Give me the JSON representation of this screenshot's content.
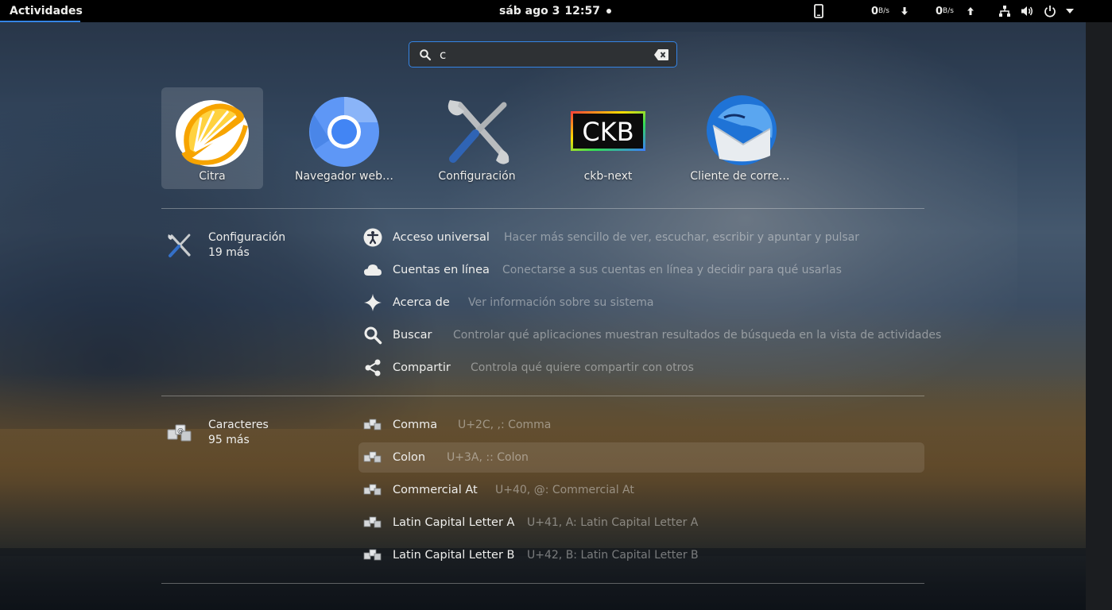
{
  "topbar": {
    "activities": "Actividades",
    "date": "sáb ago 3",
    "time": "12:57",
    "net_down_value": "0",
    "net_down_unit": "B/s",
    "net_up_value": "0",
    "net_up_unit": "B/s"
  },
  "search": {
    "value": "c"
  },
  "apps": [
    {
      "label": "Citra",
      "icon": "citra-icon",
      "selected": true
    },
    {
      "label": "Navegador web…",
      "icon": "chromium-icon",
      "selected": false
    },
    {
      "label": "Configuración",
      "icon": "settings-tools-icon",
      "selected": false
    },
    {
      "label": "ckb-next",
      "icon": "ckb-next-icon",
      "selected": false
    },
    {
      "label": "Cliente de corre…",
      "icon": "thunderbird-icon",
      "selected": false
    }
  ],
  "providers": [
    {
      "name": "Configuración",
      "more": "19 más",
      "icon": "settings-tools-icon",
      "results": [
        {
          "title": "Acceso universal",
          "desc": "Hacer más sencillo de ver, escuchar, escribir y apuntar y pulsar",
          "icon": "accessibility-icon"
        },
        {
          "title": "Cuentas en línea",
          "desc": "Conectarse a sus cuentas en línea y decidir para qué usarlas",
          "icon": "cloud-icon"
        },
        {
          "title": "Acerca de",
          "desc": "Ver información sobre su sistema",
          "icon": "sparkle-icon"
        },
        {
          "title": "Buscar",
          "desc": "Controlar qué aplicaciones muestran resultados de búsqueda en la vista de actividades",
          "icon": "search-icon"
        },
        {
          "title": "Compartir",
          "desc": "Controla qué quiere compartir con otros",
          "icon": "share-icon"
        }
      ]
    },
    {
      "name": "Caracteres",
      "more": "95 más",
      "icon": "characters-icon",
      "results": [
        {
          "title": "Comma",
          "desc": "U+2C, ,: Comma",
          "icon": "characters-icon"
        },
        {
          "title": "Colon",
          "desc": "U+3A, :: Colon",
          "icon": "characters-icon"
        },
        {
          "title": "Commercial At",
          "desc": "U+40, @: Commercial At",
          "icon": "characters-icon"
        },
        {
          "title": "Latin Capital Letter A",
          "desc": "U+41, A: Latin Capital Letter A",
          "icon": "characters-icon"
        },
        {
          "title": "Latin Capital Letter B",
          "desc": "U+42, B: Latin Capital Letter B",
          "icon": "characters-icon"
        }
      ]
    }
  ],
  "colors": {
    "accent": "#3584e4",
    "topbar": "#000000",
    "text": "#eeeeec"
  }
}
